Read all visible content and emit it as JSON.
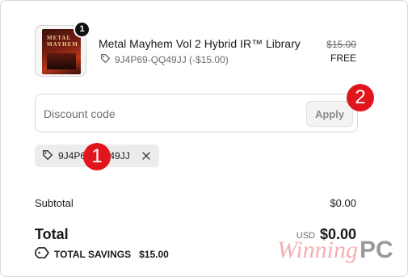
{
  "product": {
    "image_text": "METAL MAYHEM",
    "quantity": "1",
    "title": "Metal Mayhem Vol 2 Hybrid IR™ Library",
    "code_line": "9J4P69-QQ49JJ (-$15.00)",
    "original_price": "$15.00",
    "price": "FREE"
  },
  "discount": {
    "placeholder": "Discount code",
    "apply_label": "Apply"
  },
  "applied_code": {
    "code": "9J4P69-QQ49JJ"
  },
  "callouts": [
    "1",
    "2"
  ],
  "totals": {
    "subtotal_label": "Subtotal",
    "subtotal_value": "$0.00",
    "total_label": "Total",
    "currency": "USD",
    "total_value": "$0.00",
    "savings_label": "TOTAL SAVINGS",
    "savings_value": "$15.00"
  },
  "watermark": {
    "part1": "Winning",
    "part2": "PC"
  },
  "colors": {
    "callout": "#e1161c",
    "chip_bg": "#ececec"
  }
}
